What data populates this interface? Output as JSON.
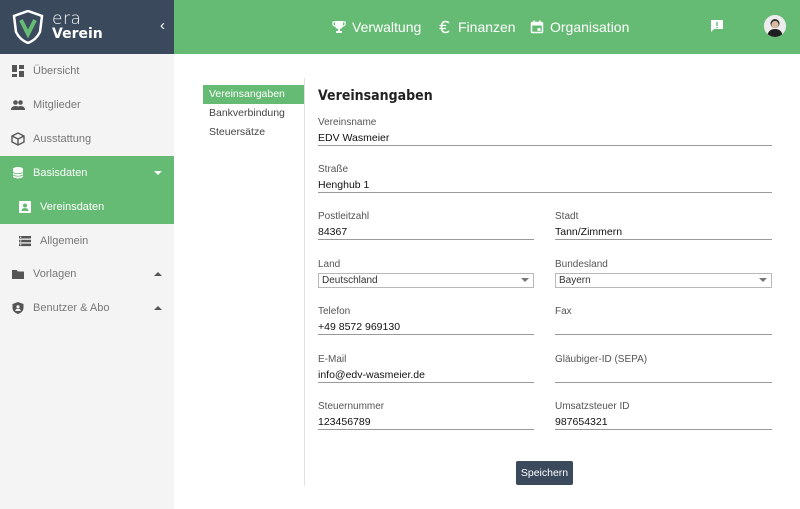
{
  "brand": {
    "line1": "era",
    "line2": "Verein"
  },
  "topnav": [
    {
      "label": "Verwaltung",
      "icon": "trophy-icon"
    },
    {
      "label": "Finanzen",
      "icon": "euro-icon"
    },
    {
      "label": "Organisation",
      "icon": "calendar-icon"
    }
  ],
  "sidebar": {
    "items": [
      {
        "label": "Übersicht",
        "icon": "dashboard-icon"
      },
      {
        "label": "Mitglieder",
        "icon": "people-icon"
      },
      {
        "label": "Ausstattung",
        "icon": "box-icon"
      },
      {
        "label": "Basisdaten",
        "icon": "database-icon"
      },
      {
        "label": "Vereinsdaten",
        "icon": "contact-card-icon"
      },
      {
        "label": "Allgemein",
        "icon": "list-icon"
      },
      {
        "label": "Vorlagen",
        "icon": "folder-icon"
      },
      {
        "label": "Benutzer & Abo",
        "icon": "shield-user-icon"
      }
    ]
  },
  "subnav": [
    "Vereinsangaben",
    "Bankverbindung",
    "Steuersätze"
  ],
  "form": {
    "title": "Vereinsangaben",
    "vereinsname": {
      "label": "Vereinsname",
      "value": "EDV Wasmeier"
    },
    "strasse": {
      "label": "Straße",
      "value": "Henghub 1"
    },
    "plz": {
      "label": "Postleitzahl",
      "value": "84367"
    },
    "stadt": {
      "label": "Stadt",
      "value": "Tann/Zimmern"
    },
    "land": {
      "label": "Land",
      "value": "Deutschland"
    },
    "bundesland": {
      "label": "Bundesland",
      "value": "Bayern"
    },
    "telefon": {
      "label": "Telefon",
      "value": "+49 8572 969130"
    },
    "fax": {
      "label": "Fax",
      "value": ""
    },
    "email": {
      "label": "E-Mail",
      "value": "info@edv-wasmeier.de"
    },
    "glaeubiger": {
      "label": "Gläubiger-ID (SEPA)",
      "value": ""
    },
    "steuernummer": {
      "label": "Steuernummer",
      "value": "123456789"
    },
    "ust": {
      "label": "Umsatzsteuer ID",
      "value": "987654321"
    },
    "save_label": "Speichern"
  },
  "colors": {
    "accent": "#66bb74",
    "dark": "#3a4a5c"
  }
}
